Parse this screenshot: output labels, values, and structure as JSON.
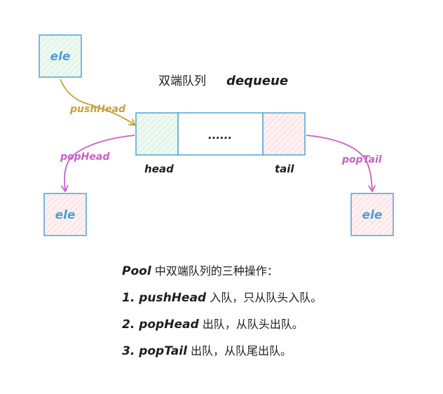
{
  "diagram": {
    "title_cn": "双端队列",
    "title_en": "dequeue",
    "element_label": "ele",
    "middle_label": "......",
    "head_label": "head",
    "tail_label": "tail",
    "push_head_label": "pushHead",
    "pop_head_label": "popHead",
    "pop_tail_label": "popTail",
    "colors": {
      "box_stroke": "#5aa8d6",
      "green_fill": "#e6f6ec",
      "red_fill": "#fde8ea",
      "push_arrow": "#c8a03a",
      "pop_arrow": "#c760c4",
      "text": "#1e1e1e",
      "ele_text": "#4b9fd6"
    }
  },
  "caption": {
    "line1_em": "Pool",
    "line1_text": "中双端队列的三种操作：",
    "line2_em": "1. pushHead",
    "line2_text": "入队，只从队头入队。",
    "line3_em": "2. popHead",
    "line3_text": "出队，从队头出队。",
    "line4_em": "3. popTail",
    "line4_text": "出队，从队尾出队。"
  }
}
